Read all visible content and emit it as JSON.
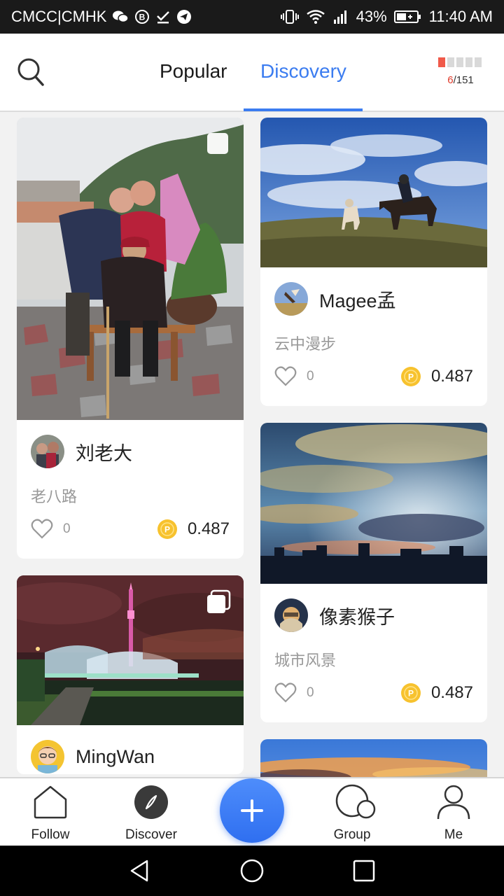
{
  "status_bar": {
    "carrier": "CMCC|CMHK",
    "battery": "43%",
    "time": "11:40 AM"
  },
  "header": {
    "tabs": [
      {
        "label": "Popular",
        "active": false
      },
      {
        "label": "Discovery",
        "active": true
      }
    ],
    "progress": {
      "current": "6",
      "total": "/151"
    },
    "accent_color": "#3b7cf0"
  },
  "feed": {
    "left": [
      {
        "author": "刘老大",
        "title": "老八路",
        "likes": "0",
        "reward": "0.487",
        "image": "family-photo",
        "multi": false
      },
      {
        "author": "MingWan",
        "title": "",
        "likes": "",
        "reward": "",
        "image": "night-city-tower",
        "multi": true
      }
    ],
    "right": [
      {
        "author": "Magee孟",
        "title": "云中漫步",
        "likes": "0",
        "reward": "0.487",
        "image": "horses-on-hill"
      },
      {
        "author": "像素猴子",
        "title": "城市风景",
        "likes": "0",
        "reward": "0.487",
        "image": "city-sunset-sky"
      }
    ]
  },
  "bottom_nav": {
    "items": [
      {
        "label": "Follow",
        "icon": "home-icon"
      },
      {
        "label": "Discover",
        "icon": "compass-icon"
      },
      {
        "label": "Group",
        "icon": "group-icon"
      },
      {
        "label": "Me",
        "icon": "person-icon"
      }
    ],
    "fab_icon": "plus-icon"
  }
}
